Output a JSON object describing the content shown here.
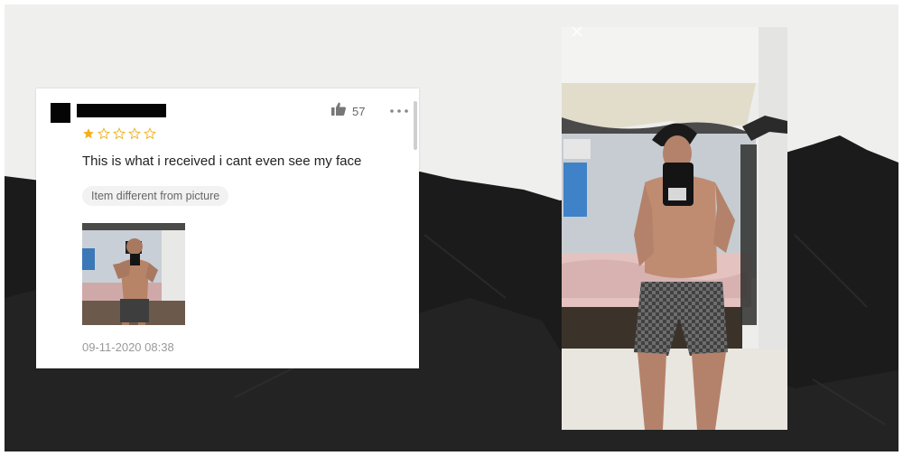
{
  "review": {
    "like_count": "57",
    "rating": 1,
    "rating_max": 5,
    "text": "This is what i received i cant even see my face",
    "tag": "Item different from picture",
    "date": "09-11-2020 08:38"
  },
  "icons": {
    "like": "thumbs-up-icon",
    "more": "more-dots-icon",
    "star_filled": "star-filled-icon",
    "star_empty": "star-outline-icon",
    "close": "close-icon"
  },
  "colors": {
    "star": "#f2b01e",
    "text_primary": "#222222",
    "text_secondary": "#999999",
    "chip_bg": "#f2f2f2"
  }
}
